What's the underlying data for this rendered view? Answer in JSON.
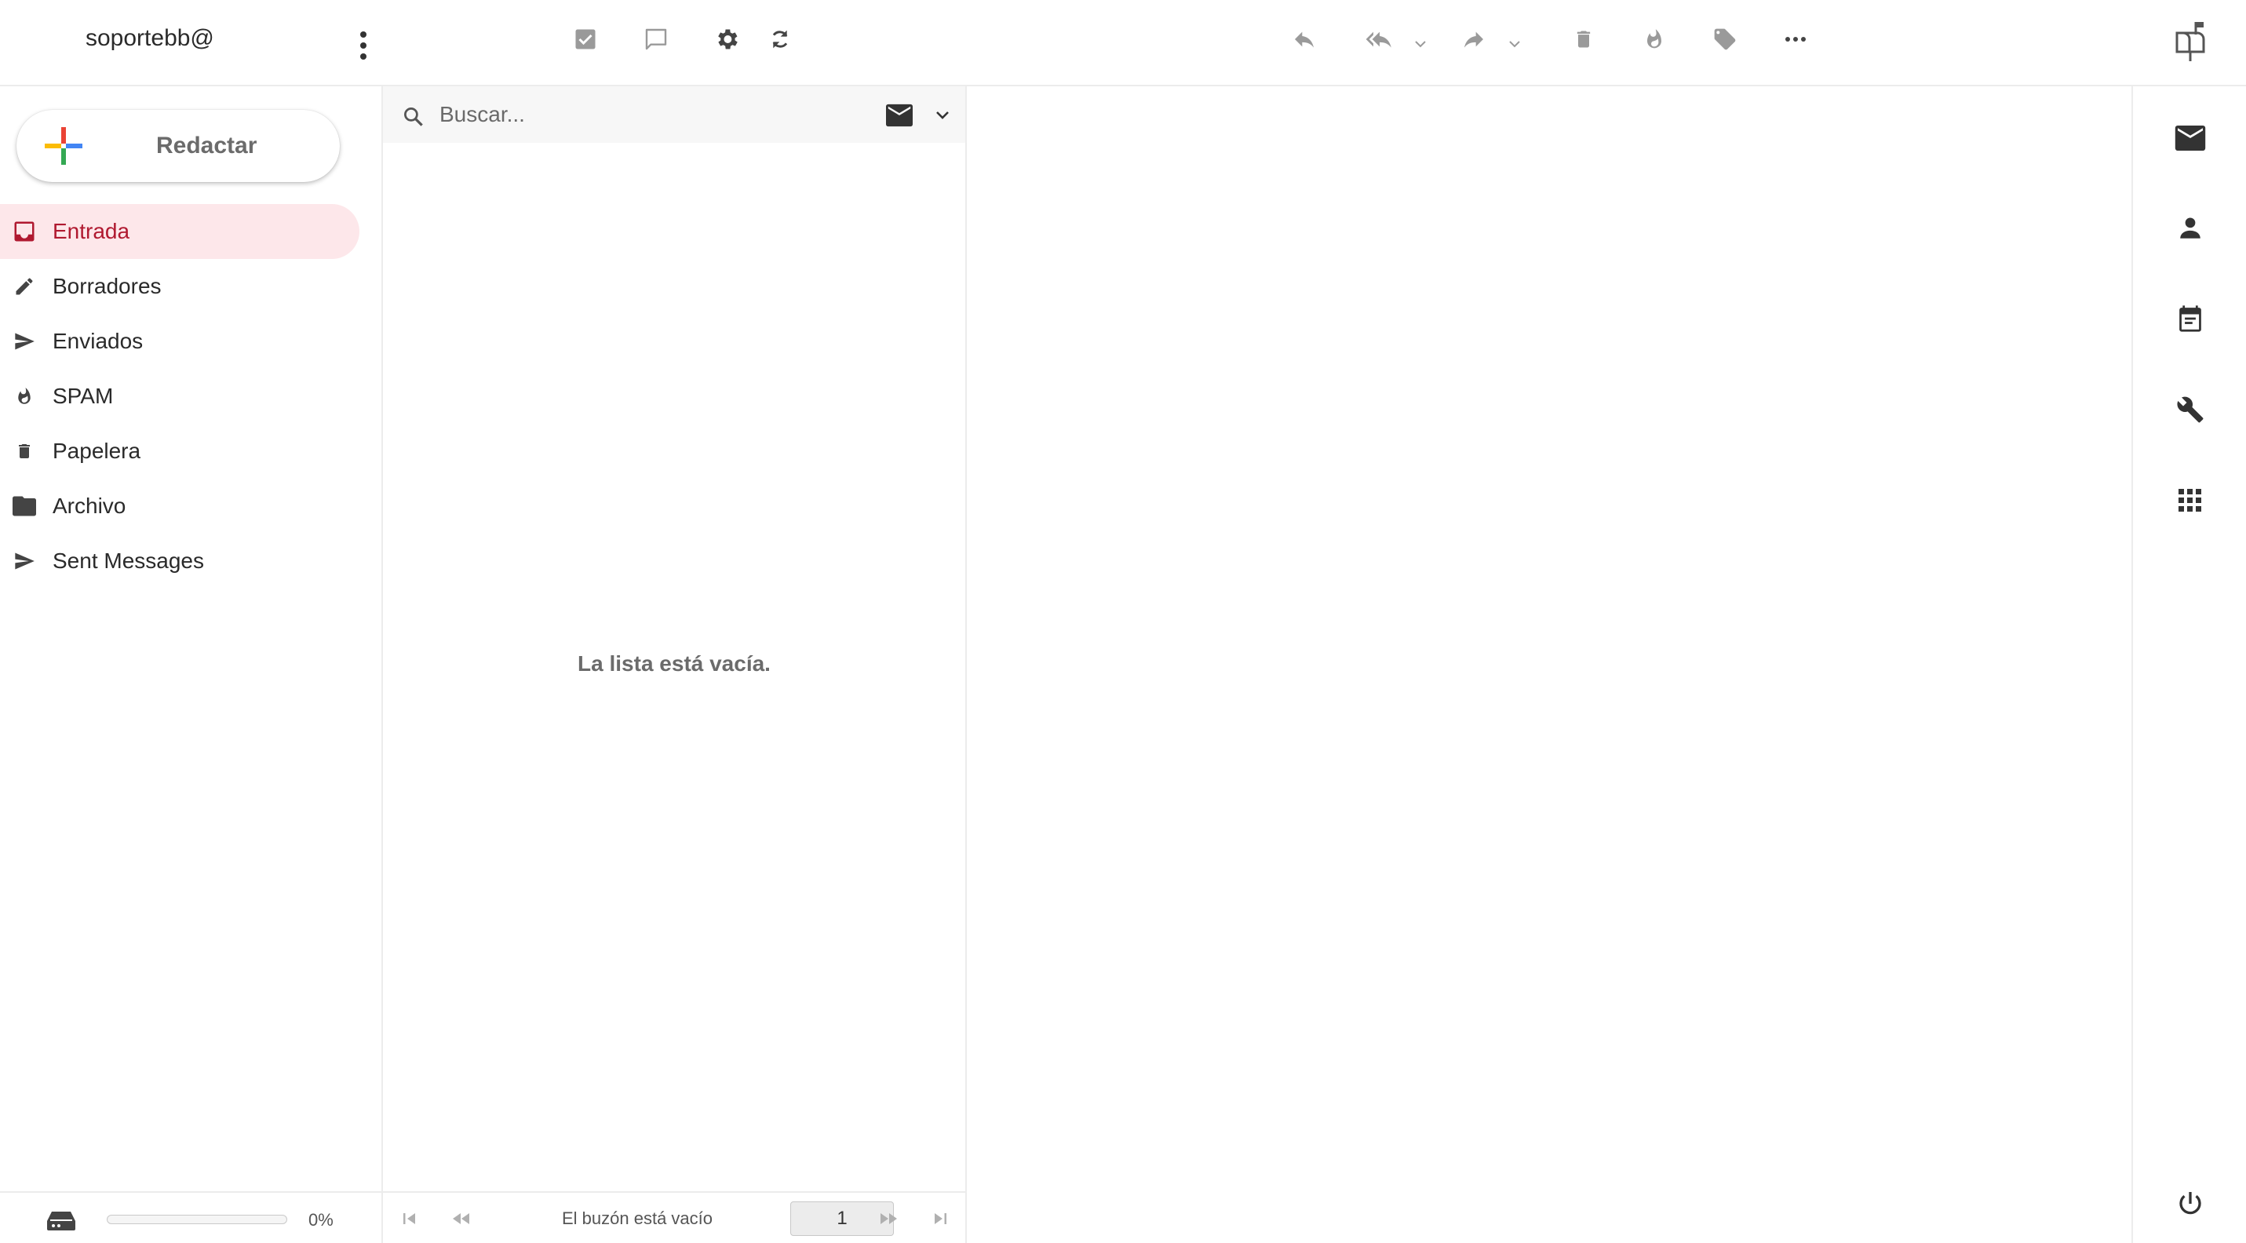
{
  "header": {
    "account": "soportebb@",
    "toolbar": {
      "select": "select-checkbox-icon",
      "threads": "threads-icon",
      "settings": "gear-icon",
      "refresh": "refresh-icon",
      "reply": "reply-icon",
      "reply_all": "reply-all-icon",
      "forward": "forward-icon",
      "delete": "trash-icon",
      "spam": "fire-icon",
      "tag": "tag-icon",
      "more": "more-icon"
    }
  },
  "sidebar": {
    "compose_label": "Redactar",
    "folders": [
      {
        "label": "Entrada",
        "icon": "inbox-icon",
        "active": true
      },
      {
        "label": "Borradores",
        "icon": "pencil-icon"
      },
      {
        "label": "Enviados",
        "icon": "send-icon"
      },
      {
        "label": "SPAM",
        "icon": "fire-icon"
      },
      {
        "label": "Papelera",
        "icon": "trash-icon"
      },
      {
        "label": "Archivo",
        "icon": "folder-icon"
      },
      {
        "label": "Sent Messages",
        "icon": "send-icon"
      }
    ],
    "quota": {
      "percent_text": "0%",
      "fraction": 0.0
    }
  },
  "list": {
    "search_placeholder": "Buscar...",
    "empty_message": "La lista está vacía.",
    "footer": {
      "status": "El buzón está vacío",
      "page": "1"
    }
  },
  "taskbar": [
    "mail-icon",
    "contacts-icon",
    "calendar-icon",
    "settings-wrench-icon",
    "apps-grid-icon",
    "logout-icon"
  ],
  "colors": {
    "accent": "#b01930",
    "active_bg": "#fde7ea",
    "icon": "#555555"
  }
}
